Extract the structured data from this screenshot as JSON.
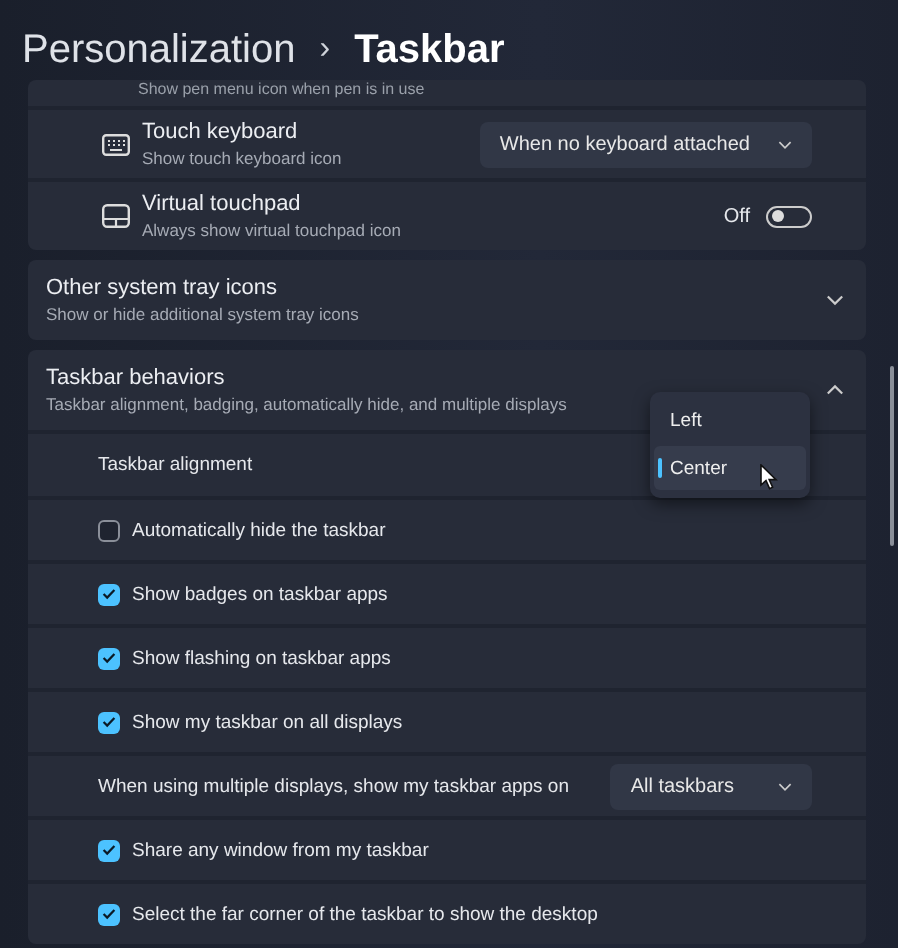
{
  "breadcrumb": {
    "parent": "Personalization",
    "separator": "›",
    "current": "Taskbar"
  },
  "top_card": {
    "cut_caption": "Show pen menu icon when pen is in use",
    "rows": [
      {
        "kind": "dropdown",
        "title": "Touch keyboard",
        "caption": "Show touch keyboard icon",
        "value": "When no keyboard attached"
      },
      {
        "kind": "toggle",
        "title": "Virtual touchpad",
        "caption": "Always show virtual touchpad icon",
        "state_label": "Off",
        "on": false
      }
    ]
  },
  "sections": [
    {
      "title": "Other system tray icons",
      "caption": "Show or hide additional system tray icons",
      "expanded": false
    },
    {
      "title": "Taskbar behaviors",
      "caption": "Taskbar alignment, badging, automatically hide, and multiple displays",
      "expanded": true,
      "rows": [
        {
          "kind": "label",
          "label": "Taskbar alignment"
        },
        {
          "kind": "checkbox",
          "label": "Automatically hide the taskbar",
          "checked": false
        },
        {
          "kind": "checkbox",
          "label": "Show badges on taskbar apps",
          "checked": true
        },
        {
          "kind": "checkbox",
          "label": "Show flashing on taskbar apps",
          "checked": true
        },
        {
          "kind": "checkbox",
          "label": "Show my taskbar on all displays",
          "checked": true
        },
        {
          "kind": "dropdown",
          "label": "When using multiple displays, show my taskbar apps on",
          "value": "All taskbars"
        },
        {
          "kind": "checkbox",
          "label": "Share any window from my taskbar",
          "checked": true
        },
        {
          "kind": "checkbox",
          "label": "Select the far corner of the taskbar to show the desktop",
          "checked": true
        }
      ]
    }
  ],
  "alignment_menu": {
    "options": [
      {
        "label": "Left",
        "selected": false
      },
      {
        "label": "Center",
        "selected": true
      }
    ]
  }
}
